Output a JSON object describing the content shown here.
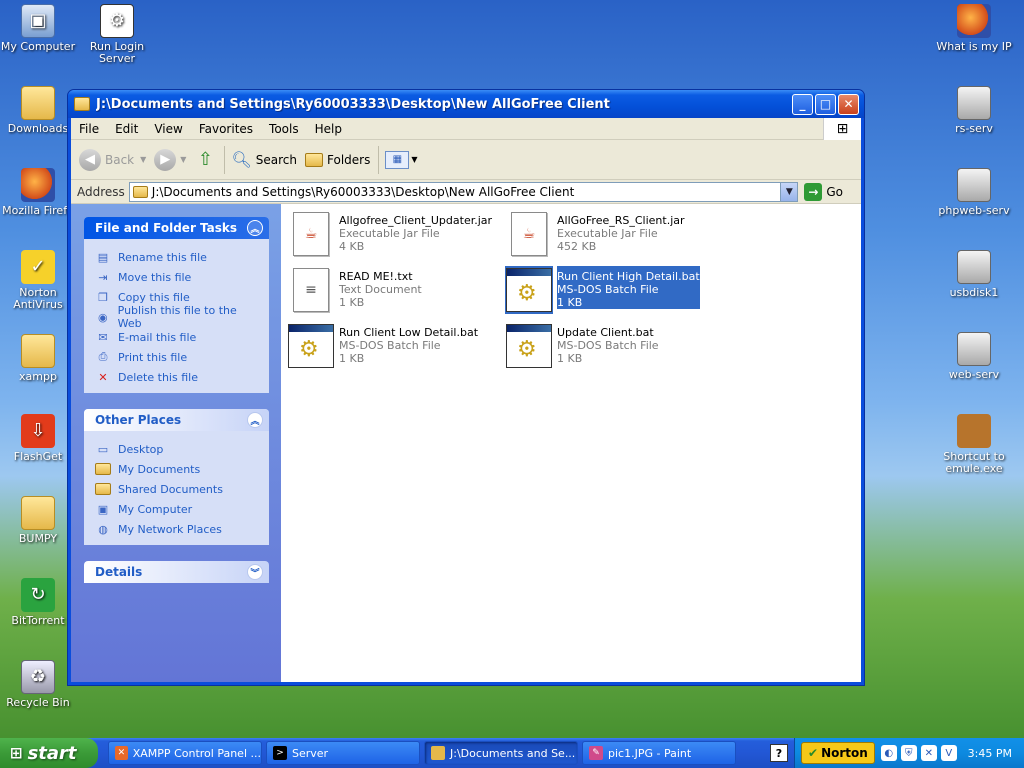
{
  "desktop_icons": [
    {
      "label": "My Computer",
      "icon": "computer-icon"
    },
    {
      "label": "Run Login Server",
      "icon": "application-icon"
    },
    {
      "label": "Downloads",
      "icon": "folder-icon"
    },
    {
      "label": "Mozilla Firefo",
      "icon": "firefox-icon"
    },
    {
      "label": "Norton AntiVirus",
      "icon": "norton-icon"
    },
    {
      "label": "xampp",
      "icon": "folder-icon"
    },
    {
      "label": "FlashGet",
      "icon": "flashget-icon"
    },
    {
      "label": "BUMPY",
      "icon": "folder-icon"
    },
    {
      "label": "BitTorrent",
      "icon": "bittorrent-icon"
    },
    {
      "label": "Recycle Bin",
      "icon": "recycle-bin-icon"
    },
    {
      "label": "What is my IP",
      "icon": "firefox-icon"
    },
    {
      "label": "rs-serv",
      "icon": "server-icon"
    },
    {
      "label": "phpweb-serv",
      "icon": "server-icon"
    },
    {
      "label": "usbdisk1",
      "icon": "server-icon"
    },
    {
      "label": "web-serv",
      "icon": "server-icon"
    },
    {
      "label": "Shortcut to emule.exe",
      "icon": "emule-icon"
    }
  ],
  "window": {
    "title": "J:\\Documents and Settings\\Ry60003333\\Desktop\\New AllGoFree Client",
    "menu": [
      "File",
      "Edit",
      "View",
      "Favorites",
      "Tools",
      "Help"
    ],
    "toolbar": {
      "back": "Back",
      "search": "Search",
      "folders": "Folders"
    },
    "address_label": "Address",
    "address_value": "J:\\Documents and Settings\\Ry60003333\\Desktop\\New AllGoFree Client",
    "go_label": "Go"
  },
  "tasks_pane": {
    "file_tasks": {
      "title": "File and Folder Tasks",
      "items": [
        "Rename this file",
        "Move this file",
        "Copy this file",
        "Publish this file to the Web",
        "E-mail this file",
        "Print this file",
        "Delete this file"
      ]
    },
    "other_places": {
      "title": "Other Places",
      "items": [
        "Desktop",
        "My Documents",
        "Shared Documents",
        "My Computer",
        "My Network Places"
      ]
    },
    "details": {
      "title": "Details"
    }
  },
  "files": [
    {
      "name": "Allgofree_Client_Updater.jar",
      "type": "Executable Jar File",
      "size": "4 KB",
      "icon": "jar-file-icon",
      "selected": false
    },
    {
      "name": "AllGoFree_RS_Client.jar",
      "type": "Executable Jar File",
      "size": "452 KB",
      "icon": "jar-file-icon",
      "selected": false
    },
    {
      "name": "READ ME!.txt",
      "type": "Text Document",
      "size": "1 KB",
      "icon": "text-file-icon",
      "selected": false
    },
    {
      "name": "Run Client High Detail.bat",
      "type": "MS-DOS Batch File",
      "size": "1 KB",
      "icon": "batch-file-icon",
      "selected": true
    },
    {
      "name": "Run Client Low Detail.bat",
      "type": "MS-DOS Batch File",
      "size": "1 KB",
      "icon": "batch-file-icon",
      "selected": false
    },
    {
      "name": "Update Client.bat",
      "type": "MS-DOS Batch File",
      "size": "1 KB",
      "icon": "batch-file-icon",
      "selected": false
    }
  ],
  "taskbar": {
    "start_label": "start",
    "tasks": [
      {
        "label": "XAMPP Control Panel ...",
        "icon": "xampp-icon"
      },
      {
        "label": "Server",
        "icon": "console-icon"
      },
      {
        "label": "J:\\Documents and Se...",
        "icon": "folder-icon"
      },
      {
        "label": "pic1.JPG - Paint",
        "icon": "paint-icon"
      }
    ],
    "norton_label": "Norton",
    "clock": "3:45 PM"
  }
}
